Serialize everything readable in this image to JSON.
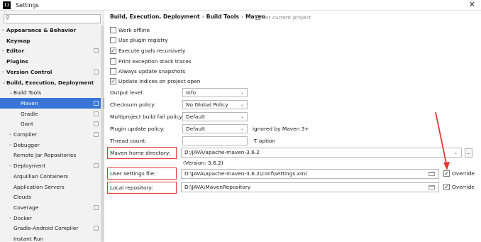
{
  "window": {
    "title": "Settings",
    "app_icon_text": "IJ",
    "close_glyph": "✕"
  },
  "sidebar": {
    "search_placeholder": "",
    "items": [
      {
        "label": "Appearance & Behavior",
        "bold": true,
        "arrow": "›",
        "selected": false
      },
      {
        "label": "Keymap",
        "bold": true,
        "arrow": "",
        "selected": false
      },
      {
        "label": "Editor",
        "bold": true,
        "arrow": "›",
        "selected": false
      },
      {
        "label": "Plugins",
        "bold": true,
        "arrow": "",
        "selected": false
      },
      {
        "label": "Version Control",
        "bold": true,
        "arrow": "›",
        "selected": false
      },
      {
        "label": "Build, Execution, Deployment",
        "bold": true,
        "arrow": "⌄",
        "selected": false
      },
      {
        "label": "Build Tools",
        "bold": false,
        "arrow": "⌄",
        "selected": false
      },
      {
        "label": "Maven",
        "bold": false,
        "arrow": "",
        "selected": true
      },
      {
        "label": "Gradle",
        "bold": false,
        "arrow": "",
        "selected": false
      },
      {
        "label": "Gant",
        "bold": false,
        "arrow": "",
        "selected": false
      },
      {
        "label": "Compiler",
        "bold": false,
        "arrow": "›",
        "selected": false
      },
      {
        "label": "Debugger",
        "bold": false,
        "arrow": "›",
        "selected": false
      },
      {
        "label": "Remote Jar Repositories",
        "bold": false,
        "arrow": "",
        "selected": false
      },
      {
        "label": "Deployment",
        "bold": false,
        "arrow": "›",
        "selected": false
      },
      {
        "label": "Arquillian Containers",
        "bold": false,
        "arrow": "",
        "selected": false
      },
      {
        "label": "Application Servers",
        "bold": false,
        "arrow": "",
        "selected": false
      },
      {
        "label": "Clouds",
        "bold": false,
        "arrow": "",
        "selected": false
      },
      {
        "label": "Coverage",
        "bold": false,
        "arrow": "",
        "selected": false
      },
      {
        "label": "Docker",
        "bold": false,
        "arrow": "›",
        "selected": false
      },
      {
        "label": "Gradle-Android Compiler",
        "bold": false,
        "arrow": "",
        "selected": false
      },
      {
        "label": "Instant Run",
        "bold": false,
        "arrow": "",
        "selected": false
      }
    ]
  },
  "breadcrumb": {
    "part1": "Build, Execution, Deployment",
    "part2": "Build Tools",
    "part3": "Maven",
    "separator": "›"
  },
  "for_project": "For current project",
  "checkboxes": [
    {
      "label": "Work offline",
      "checked": false
    },
    {
      "label": "Use plugin registry",
      "checked": false
    },
    {
      "label": "Execute goals recursively",
      "checked": true
    },
    {
      "label": "Print exception stack traces",
      "checked": false
    },
    {
      "label": "Always update snapshots",
      "checked": false
    },
    {
      "label": "Update indices on project open",
      "checked": true
    }
  ],
  "fields": {
    "output_level": {
      "label": "Output level:",
      "value": "Info"
    },
    "checksum_policy": {
      "label": "Checksum policy:",
      "value": "No Global Policy"
    },
    "multiproject_policy": {
      "label": "Multiproject build fail policy:",
      "value": "Default"
    },
    "plugin_update_policy": {
      "label": "Plugin update policy:",
      "value": "Default",
      "hint": "ignored by Maven 3+"
    },
    "thread_count": {
      "label": "Thread count:",
      "value": "",
      "hint": "-T option"
    },
    "maven_home": {
      "label": "Maven home directory:",
      "value": "D:/JAVA/apache-maven-3.6.2",
      "version": "(Version: 3.6.2)"
    },
    "user_settings": {
      "label": "User settings file:",
      "value": "D:\\JAVA\\apache-maven-3.6.2\\conf\\settings.xml",
      "override_label": "Override",
      "override_checked": true
    },
    "local_repo": {
      "label": "Local repository:",
      "value": "D:\\JAVA\\MavenRepository",
      "override_label": "Override",
      "override_checked": true
    }
  },
  "icons": {
    "search": "search-icon",
    "folder": "folder-icon",
    "chevron": "⌄",
    "check": "✓",
    "browse": "..."
  },
  "colors": {
    "selection": "#3875d7",
    "annotation_red": "#e53935",
    "sidebar_bg": "#f2f2f2"
  }
}
